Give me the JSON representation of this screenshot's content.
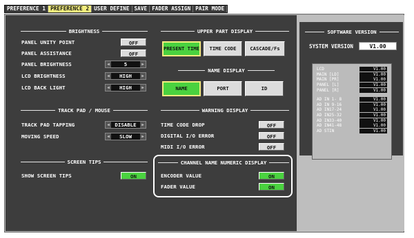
{
  "tabs": [
    {
      "label": "PREFERENCE 1",
      "active": false
    },
    {
      "label": "PREFERENCE 2",
      "active": true
    },
    {
      "label": "USER DEFINE",
      "active": false
    },
    {
      "label": "SAVE",
      "active": false
    },
    {
      "label": "FADER ASSIGN",
      "active": false
    },
    {
      "label": "PAIR MODE",
      "active": false
    }
  ],
  "brightness": {
    "title": "BRIGHTNESS",
    "panel_unity_point": {
      "label": "PANEL UNITY POINT",
      "value": "OFF"
    },
    "panel_assistance": {
      "label": "PANEL ASSISTANCE",
      "value": "OFF"
    },
    "panel_brightness": {
      "label": "PANEL BRIGHTNESS",
      "value": "5"
    },
    "lcd_brightness": {
      "label": "LCD BRIGHTNESS",
      "value": "HIGH"
    },
    "lcd_back_light": {
      "label": "LCD BACK LIGHT",
      "value": "HIGH"
    }
  },
  "trackpad": {
    "title": "TRACK PAD / MOUSE",
    "tapping": {
      "label": "TRACK PAD TAPPING",
      "value": "DISABLE"
    },
    "moving_speed": {
      "label": "MOVING SPEED",
      "value": "SLOW"
    }
  },
  "screen_tips": {
    "title": "SCREEN TIPS",
    "show": {
      "label": "SHOW SCREEN TIPS",
      "value": "ON"
    }
  },
  "upper_display": {
    "title": "UPPER PART DISPLAY",
    "present_time": "PRESENT TIME",
    "time_code": "TIME CODE",
    "cascade": "CASCADE/Fs"
  },
  "name_display": {
    "title": "NAME DISPLAY",
    "name": "NAME",
    "port": "PORT",
    "id": "ID"
  },
  "warning": {
    "title": "WARNING DISPLAY",
    "time_code_drop": {
      "label": "TIME CODE DROP",
      "value": "OFF"
    },
    "digital_io": {
      "label": "DIGITAL I/O ERROR",
      "value": "OFF"
    },
    "midi_io": {
      "label": "MIDI I/O ERROR",
      "value": "OFF"
    }
  },
  "channel_numeric": {
    "title": "CHANNEL NAME NUMERIC DISPLAY",
    "encoder": {
      "label": "ENCODER VALUE",
      "value": "ON"
    },
    "fader": {
      "label": "FADER VALUE",
      "value": "ON"
    }
  },
  "software": {
    "title": "SOFTWARE VERSION",
    "system_label": "SYSTEM VERSION",
    "system_value": "V1.00",
    "modules": [
      {
        "name": "LCD",
        "value": "V1.00"
      },
      {
        "name": "MAIN [LD]",
        "value": "V1.00"
      },
      {
        "name": "MAIN [PR]",
        "value": "V1.00"
      },
      {
        "name": "PANEL [L]",
        "value": "V1.00"
      },
      {
        "name": "PANEL [R]",
        "value": "V1.00"
      }
    ],
    "ad_modules": [
      {
        "name": "AD IN 1- 8",
        "value": "V1.00"
      },
      {
        "name": "AD IN 9-16",
        "value": "V1.00"
      },
      {
        "name": "AD IN17-24",
        "value": "V1.00"
      },
      {
        "name": "AD IN25-32",
        "value": "V1.00"
      },
      {
        "name": "AD IN33-40",
        "value": "V1.00"
      },
      {
        "name": "AD IN41-48",
        "value": "V1.00"
      },
      {
        "name": "AD STIN",
        "value": "V1.00"
      }
    ]
  },
  "colors": {
    "on_green": "#4ad23f",
    "active_tab": "#f4ee7e",
    "panel": "#3d3d3d"
  }
}
